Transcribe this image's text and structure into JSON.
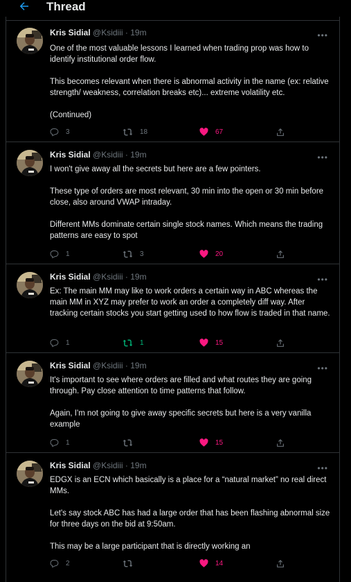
{
  "header": {
    "title": "Thread"
  },
  "colors": {
    "like": "#f91880",
    "retweet_active": "#00ba7c",
    "accent": "#1d9bf0"
  },
  "tweets": [
    {
      "name": "Kris Sidial",
      "handle_time": "@Ksidiii · 19m",
      "paragraphs": [
        "One of the most valuable lessons I learned when trading prop was how to identify institutional order flow.",
        "This becomes relevant when there is abnormal activity in the name (ex: relative strength/ weakness, correlation breaks etc)... extreme volatility etc.",
        "(Continued)"
      ],
      "replies": "3",
      "retweets": "18",
      "likes": "67",
      "retweet_active": false
    },
    {
      "name": "Kris Sidial",
      "handle_time": "@Ksidiii · 19m",
      "paragraphs": [
        "I won't give away all the secrets but here are a few pointers.",
        "These type of orders are most relevant, 30 min into the open or 30 min before close, also around VWAP intraday.",
        "Different MMs dominate certain single stock names. Which means the trading patterns are easy to spot"
      ],
      "replies": "1",
      "retweets": "3",
      "likes": "20",
      "retweet_active": false
    },
    {
      "name": "Kris Sidial",
      "handle_time": "@Ksidiii · 19m",
      "paragraphs": [
        "Ex: The main MM may like to work orders a certain way in ABC whereas the main MM in XYZ may prefer to work an order a completely diff way. After tracking certain stocks you start getting used to how flow is traded in that name."
      ],
      "replies": "1",
      "retweets": "1",
      "likes": "15",
      "retweet_active": true
    },
    {
      "name": "Kris Sidial",
      "handle_time": "@Ksidiii · 19m",
      "paragraphs": [
        "It's important to see where orders are filled and what routes they are going through. Pay close attention to time patterns that follow.",
        "Again, I'm not going to give away specific secrets but here is a very vanilla example"
      ],
      "replies": "1",
      "retweets": "",
      "likes": "15",
      "retweet_active": false
    },
    {
      "name": "Kris Sidial",
      "handle_time": "@Ksidiii · 19m",
      "paragraphs": [
        "EDGX is an ECN which basically is a place for a “natural market” no real direct MMs.",
        "Let's say stock ABC has had a large order that has been flashing abnormal size for three days on the bid at 9:50am.",
        "This may be a large participant that is directly working an"
      ],
      "replies": "2",
      "retweets": "",
      "likes": "14",
      "retweet_active": false
    }
  ]
}
